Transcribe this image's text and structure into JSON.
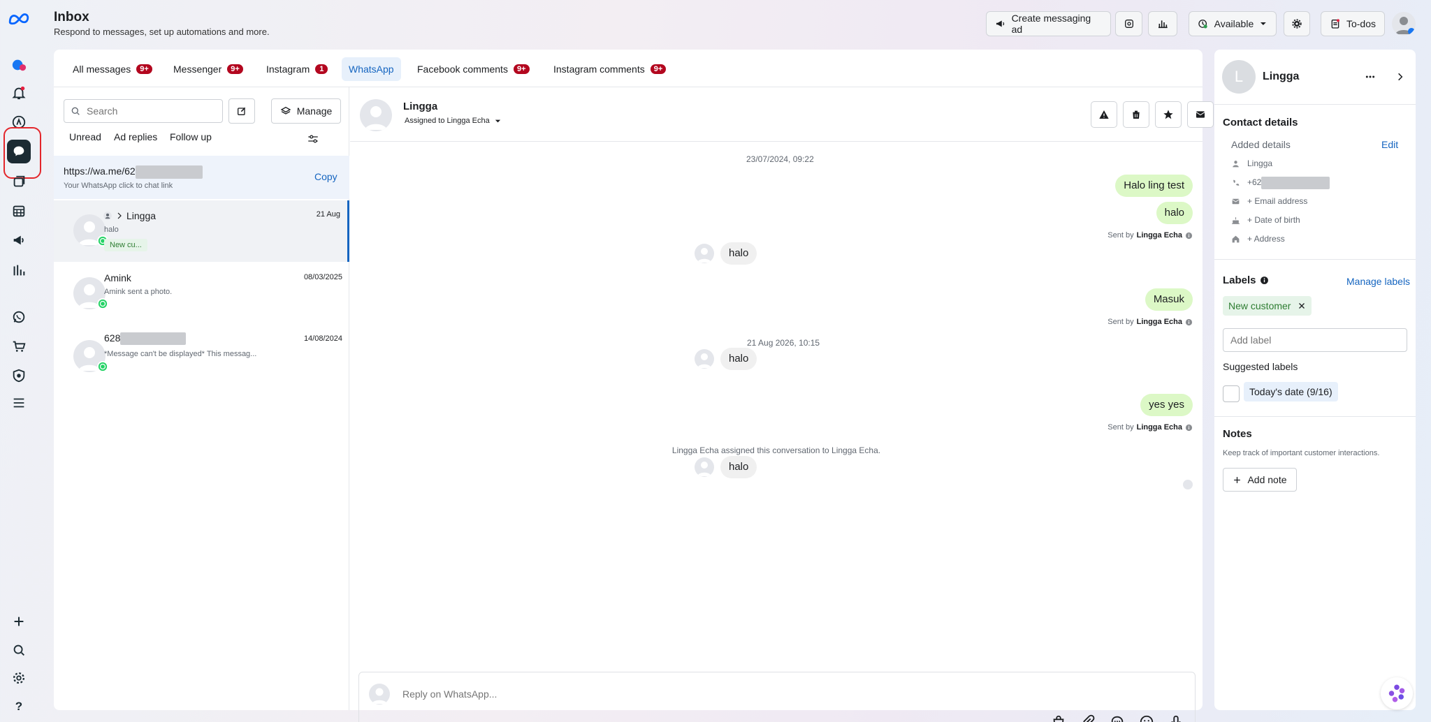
{
  "header": {
    "title": "Inbox",
    "subtitle": "Respond to messages, set up automations and more.",
    "create_ad_label": "Create messaging ad",
    "status_label": "Available",
    "todos_label": "To-dos"
  },
  "tabs": [
    {
      "label": "All messages",
      "badge": "9+"
    },
    {
      "label": "Messenger",
      "badge": "9+"
    },
    {
      "label": "Instagram",
      "badge": "1"
    },
    {
      "label": "WhatsApp",
      "badge": ""
    },
    {
      "label": "Facebook comments",
      "badge": "9+"
    },
    {
      "label": "Instagram comments",
      "badge": "9+"
    }
  ],
  "list": {
    "search_placeholder": "Search",
    "manage_label": "Manage",
    "filters": [
      "Unread",
      "Ad replies",
      "Follow up"
    ],
    "link_text": "https://wa.me/62",
    "link_caption": "Your WhatsApp click to chat link",
    "copy_label": "Copy",
    "conversations": [
      {
        "name": "Lingga",
        "preview": "halo",
        "date": "21 Aug",
        "tag": "New cu..."
      },
      {
        "name": "Amink",
        "preview": "Amink sent a photo.",
        "date": "08/03/2025",
        "tag": ""
      },
      {
        "name": "628",
        "preview": "*Message can't be displayed* This messag...",
        "date": "14/08/2024",
        "tag": ""
      }
    ]
  },
  "chat": {
    "contact_name": "Lingga",
    "assigned_text": "Assigned to Lingga Echa",
    "timestamp1": "23/07/2024, 09:22",
    "timestamp2": "21 Aug 2026, 10:15",
    "messages": [
      {
        "dir": "out",
        "text": "Halo ling test"
      },
      {
        "dir": "out",
        "text": "halo"
      },
      {
        "dir": "in",
        "text": "halo"
      },
      {
        "dir": "out",
        "text": "Masuk"
      },
      {
        "dir": "in",
        "text": "halo"
      },
      {
        "dir": "out",
        "text": "yes yes"
      },
      {
        "dir": "in",
        "text": "halo"
      }
    ],
    "sent_by_prefix": "Sent by",
    "sent_by_name": "Lingga Echa",
    "system_note": "Lingga Echa assigned this conversation to Lingga Echa.",
    "reply_placeholder": "Reply on WhatsApp..."
  },
  "panel": {
    "name": "Lingga",
    "avatar_letter": "L",
    "contact_details_title": "Contact details",
    "added_details": "Added details",
    "edit_label": "Edit",
    "detail_name": "Lingga",
    "detail_phone": "+62",
    "add_email": "+ Email address",
    "add_dob": "+ Date of birth",
    "add_address": "+ Address",
    "labels_title": "Labels",
    "manage_labels": "Manage labels",
    "label_chip": "New customer",
    "add_label_placeholder": "Add label",
    "suggested_title": "Suggested labels",
    "suggested_chip": "Today's date (9/16)",
    "notes_title": "Notes",
    "notes_desc": "Keep track of important customer interactions.",
    "add_note": "Add note"
  },
  "colors": {
    "accent": "#1565c0",
    "badge": "#b3071f",
    "outgoing_bubble": "#dcf8c6",
    "incoming_bubble": "#f0f0f0",
    "whatsapp": "#25d366",
    "highlight": "#e3262b"
  }
}
